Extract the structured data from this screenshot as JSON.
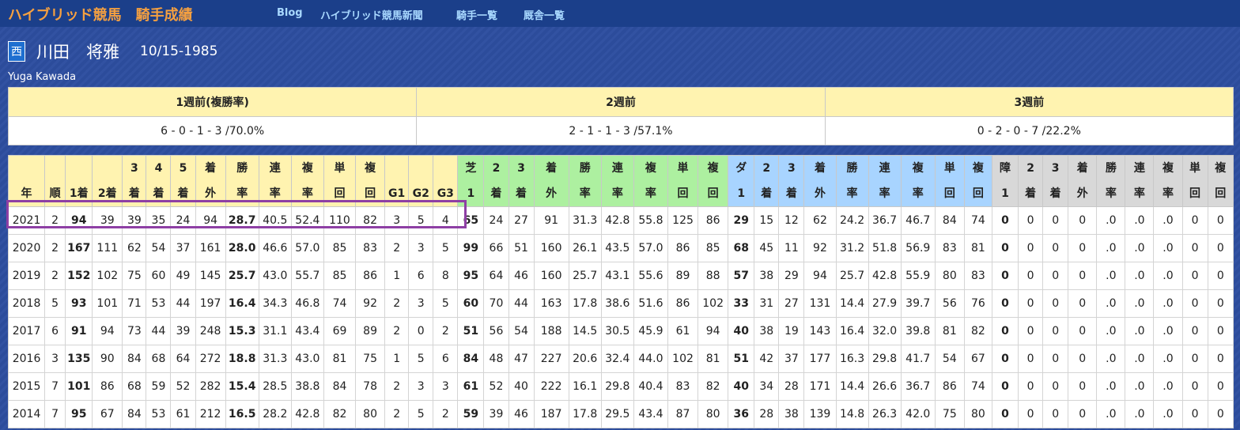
{
  "site": {
    "title": "ハイブリッド競馬",
    "subtitle": "騎手成績",
    "nav": [
      "Blog",
      "ハイブリッド競馬新聞",
      "騎手一覧",
      "厩舎一覧"
    ]
  },
  "jockey": {
    "region": "西",
    "name": "川田　将雅",
    "birthdate": "10/15-1985",
    "roman_name": "Yuga Kawada"
  },
  "weeks": {
    "headers": [
      "1週前(複勝率)",
      "2週前",
      "3週前"
    ],
    "values": [
      "6 - 0 - 1 - 3 /70.0%",
      "2 - 1 - 1 - 3 /57.1%",
      "0 - 2 - 0 - 7 /22.2%"
    ]
  },
  "stats": {
    "headers": [
      "年",
      "順",
      "1着",
      "2着",
      "3\n着",
      "4\n着",
      "5\n着",
      "着\n外",
      "勝\n率",
      "連\n率",
      "複\n率",
      "単\n回",
      "複\n回",
      "G1",
      "G2",
      "G3",
      "芝\n1",
      "2\n着",
      "3\n着",
      "着\n外",
      "勝\n率",
      "連\n率",
      "複\n率",
      "単\n回",
      "複\n回",
      "ダ\n1",
      "2\n着",
      "3\n着",
      "着\n外",
      "勝\n率",
      "連\n率",
      "複\n率",
      "単\n回",
      "複\n回",
      "障\n1",
      "2\n着",
      "3\n着",
      "着\n外",
      "勝\n率",
      "連\n率",
      "複\n率",
      "単\n回",
      "複\n回"
    ],
    "rows": [
      [
        "2021",
        "2",
        "94",
        "39",
        "39",
        "35",
        "24",
        "94",
        "28.7",
        "40.5",
        "52.4",
        "110",
        "82",
        "3",
        "5",
        "4",
        "65",
        "24",
        "27",
        "91",
        "31.3",
        "42.8",
        "55.8",
        "125",
        "86",
        "29",
        "15",
        "12",
        "62",
        "24.2",
        "36.7",
        "46.7",
        "84",
        "74",
        "0",
        "0",
        "0",
        "0",
        ".0",
        ".0",
        ".0",
        "0",
        "0"
      ],
      [
        "2020",
        "2",
        "167",
        "111",
        "62",
        "54",
        "37",
        "161",
        "28.0",
        "46.6",
        "57.0",
        "85",
        "83",
        "2",
        "3",
        "5",
        "99",
        "66",
        "51",
        "160",
        "26.1",
        "43.5",
        "57.0",
        "86",
        "85",
        "68",
        "45",
        "11",
        "92",
        "31.2",
        "51.8",
        "56.9",
        "83",
        "81",
        "0",
        "0",
        "0",
        "0",
        ".0",
        ".0",
        ".0",
        "0",
        "0"
      ],
      [
        "2019",
        "2",
        "152",
        "102",
        "75",
        "60",
        "49",
        "145",
        "25.7",
        "43.0",
        "55.7",
        "85",
        "86",
        "1",
        "6",
        "8",
        "95",
        "64",
        "46",
        "160",
        "25.7",
        "43.1",
        "55.6",
        "89",
        "88",
        "57",
        "38",
        "29",
        "94",
        "25.7",
        "42.8",
        "55.9",
        "80",
        "83",
        "0",
        "0",
        "0",
        "0",
        ".0",
        ".0",
        ".0",
        "0",
        "0"
      ],
      [
        "2018",
        "5",
        "93",
        "101",
        "71",
        "53",
        "44",
        "197",
        "16.4",
        "34.3",
        "46.8",
        "74",
        "92",
        "2",
        "3",
        "5",
        "60",
        "70",
        "44",
        "163",
        "17.8",
        "38.6",
        "51.6",
        "86",
        "102",
        "33",
        "31",
        "27",
        "131",
        "14.4",
        "27.9",
        "39.7",
        "56",
        "76",
        "0",
        "0",
        "0",
        "0",
        ".0",
        ".0",
        ".0",
        "0",
        "0"
      ],
      [
        "2017",
        "6",
        "91",
        "94",
        "73",
        "44",
        "39",
        "248",
        "15.3",
        "31.1",
        "43.4",
        "69",
        "89",
        "2",
        "0",
        "2",
        "51",
        "56",
        "54",
        "188",
        "14.5",
        "30.5",
        "45.9",
        "61",
        "94",
        "40",
        "38",
        "19",
        "143",
        "16.4",
        "32.0",
        "39.8",
        "81",
        "82",
        "0",
        "0",
        "0",
        "0",
        ".0",
        ".0",
        ".0",
        "0",
        "0"
      ],
      [
        "2016",
        "3",
        "135",
        "90",
        "84",
        "68",
        "64",
        "272",
        "18.8",
        "31.3",
        "43.0",
        "81",
        "75",
        "1",
        "5",
        "6",
        "84",
        "48",
        "47",
        "227",
        "20.6",
        "32.4",
        "44.0",
        "102",
        "81",
        "51",
        "42",
        "37",
        "177",
        "16.3",
        "29.8",
        "41.7",
        "54",
        "67",
        "0",
        "0",
        "0",
        "0",
        ".0",
        ".0",
        ".0",
        "0",
        "0"
      ],
      [
        "2015",
        "7",
        "101",
        "86",
        "68",
        "59",
        "52",
        "282",
        "15.4",
        "28.5",
        "38.8",
        "84",
        "78",
        "2",
        "3",
        "3",
        "61",
        "52",
        "40",
        "222",
        "16.1",
        "29.8",
        "40.4",
        "83",
        "82",
        "40",
        "34",
        "28",
        "171",
        "14.4",
        "26.6",
        "36.7",
        "86",
        "74",
        "0",
        "0",
        "0",
        "0",
        ".0",
        ".0",
        ".0",
        "0",
        "0"
      ],
      [
        "2014",
        "7",
        "95",
        "67",
        "84",
        "53",
        "61",
        "212",
        "16.5",
        "28.2",
        "42.8",
        "82",
        "80",
        "2",
        "5",
        "2",
        "59",
        "39",
        "46",
        "187",
        "17.8",
        "29.5",
        "43.4",
        "87",
        "80",
        "36",
        "28",
        "38",
        "139",
        "14.8",
        "26.3",
        "42.0",
        "75",
        "80",
        "0",
        "0",
        "0",
        "0",
        ".0",
        ".0",
        ".0",
        "0",
        "0"
      ]
    ]
  },
  "colors": {
    "background": "#2d4ea0",
    "site_title": "#f5a040",
    "nav": "#a8d8ff",
    "header_yellow": "#fff3b0",
    "header_green": "#adf0a0",
    "header_blue": "#a8d4ff",
    "header_gray": "#d8d8d8",
    "highlight": "#8e3fa4"
  }
}
